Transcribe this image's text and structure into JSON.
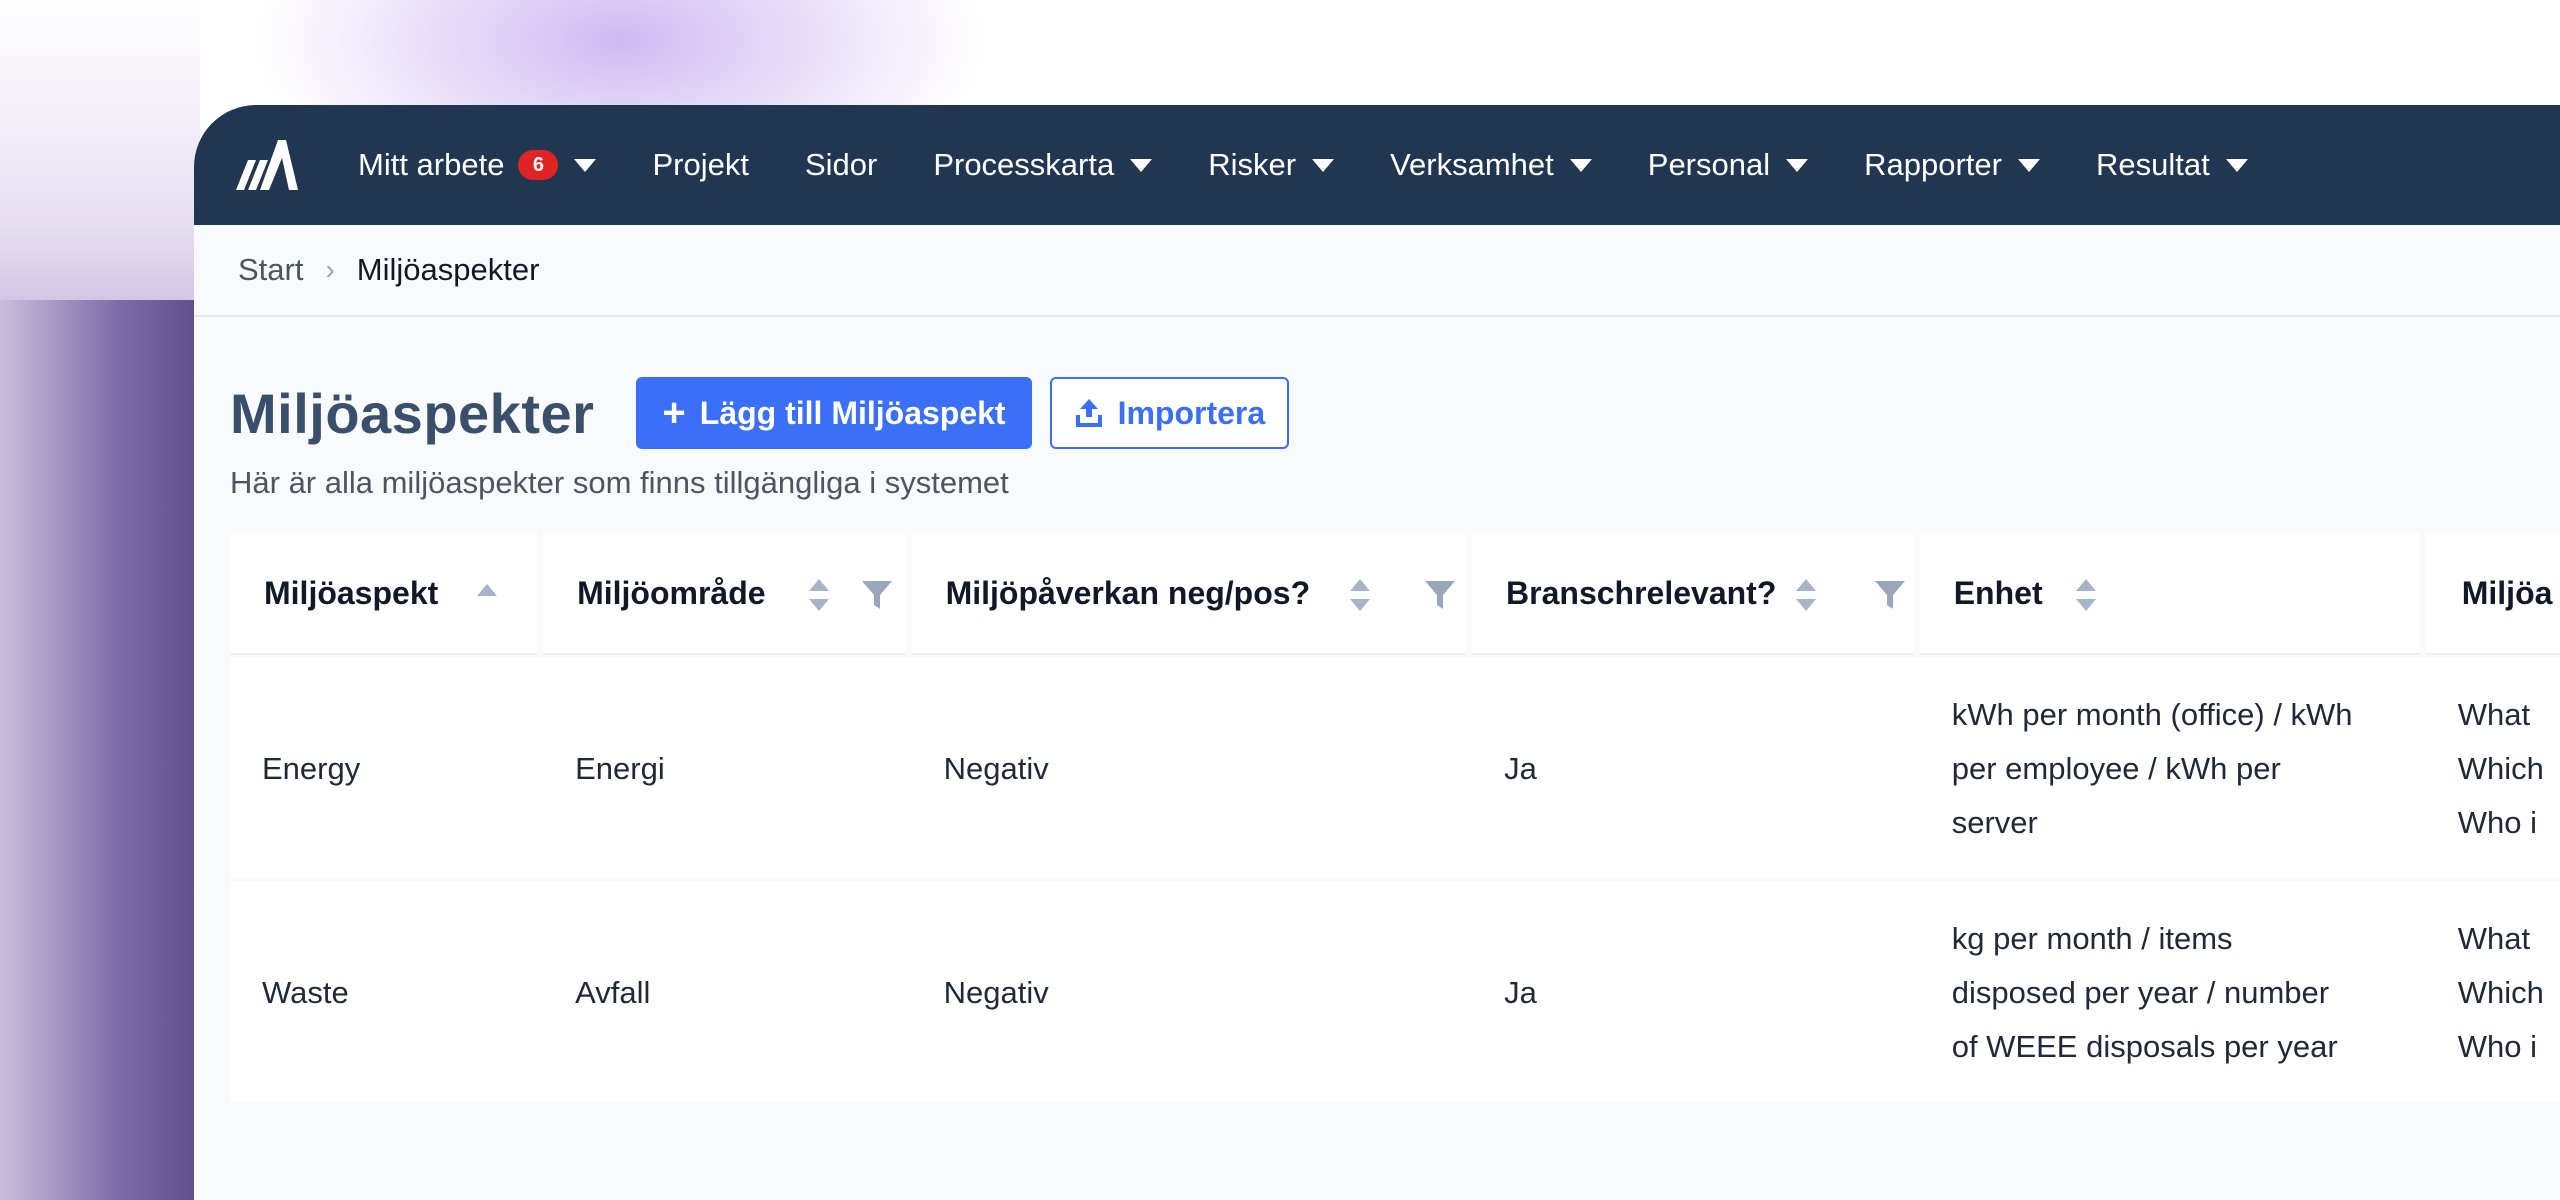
{
  "nav": {
    "items": [
      {
        "label": "Mitt arbete",
        "badge": "6",
        "dropdown": true
      },
      {
        "label": "Projekt",
        "dropdown": false
      },
      {
        "label": "Sidor",
        "dropdown": false
      },
      {
        "label": "Processkarta",
        "dropdown": true
      },
      {
        "label": "Risker",
        "dropdown": true
      },
      {
        "label": "Verksamhet",
        "dropdown": true
      },
      {
        "label": "Personal",
        "dropdown": true
      },
      {
        "label": "Rapporter",
        "dropdown": true
      },
      {
        "label": "Resultat",
        "dropdown": true
      }
    ]
  },
  "breadcrumb": {
    "start": "Start",
    "current": "Miljöaspekter"
  },
  "page": {
    "title": "Miljöaspekter",
    "add_button": "Lägg till Miljöaspekt",
    "import_button": "Importera",
    "subtitle": "Här är alla miljöaspekter som finns tillgängliga i systemet"
  },
  "table": {
    "headers": [
      "Miljöaspekt",
      "Miljöområde",
      "Miljöpåverkan neg/pos?",
      "Branschrelevant?",
      "Enhet",
      "Miljöa"
    ],
    "rows": [
      {
        "cells": [
          "Energy",
          "Energi",
          "Negativ",
          "Ja"
        ],
        "enhet": [
          "kWh per month (office) / kWh",
          "per employee / kWh per",
          "server"
        ],
        "extra": [
          "What",
          "Which",
          "Who i"
        ]
      },
      {
        "cells": [
          "Waste",
          "Avfall",
          "Negativ",
          "Ja"
        ],
        "enhet": [
          "kg per month / items",
          "disposed per year / number",
          "of WEEE disposals per year"
        ],
        "extra": [
          "What",
          "Which",
          "Who i"
        ]
      }
    ]
  },
  "colors": {
    "navbar": "#213651",
    "primary": "#3b6ff5",
    "badge": "#e02424",
    "title": "#3a4f6b"
  }
}
